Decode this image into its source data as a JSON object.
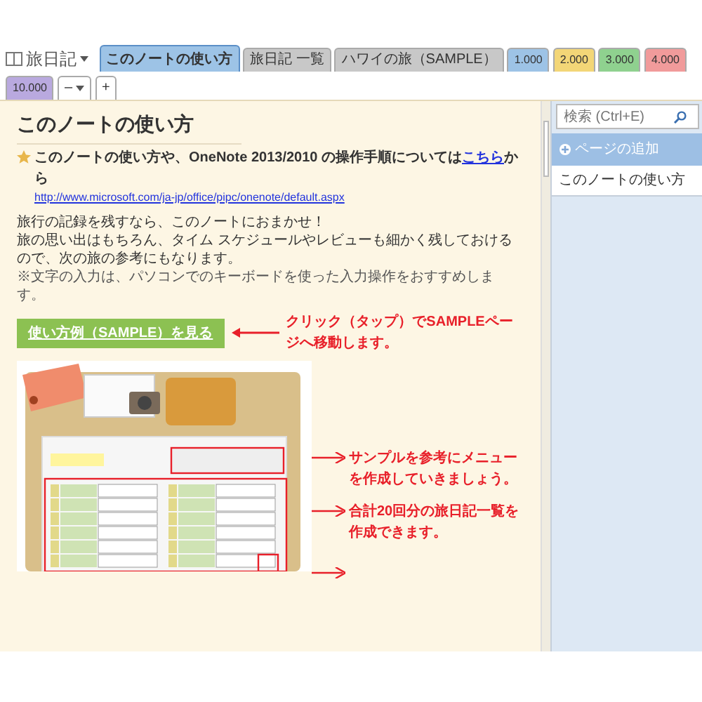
{
  "notebook": {
    "title": "旅日記"
  },
  "tabs": [
    {
      "label": "このノートの使い方",
      "selected": true,
      "color": "#9dc3e6"
    },
    {
      "label": "旅日記 一覧",
      "selected": false,
      "color": "#c8c8c8"
    },
    {
      "label": "ハワイの旅（SAMPLE）",
      "selected": false,
      "color": "#c8c8c8"
    },
    {
      "label": "1.000",
      "selected": false,
      "color": "#9dc3e6"
    },
    {
      "label": "2.000",
      "selected": false,
      "color": "#f3d677"
    },
    {
      "label": "3.000",
      "selected": false,
      "color": "#8fd18f"
    },
    {
      "label": "4.000",
      "selected": false,
      "color": "#f19b9b"
    },
    {
      "label": "10.000",
      "selected": false,
      "color": "#b9a9df"
    }
  ],
  "tab_controls": {
    "more": "–",
    "add": "+"
  },
  "search": {
    "placeholder": "検索 (Ctrl+E)"
  },
  "page_panel": {
    "add_page": "ページの追加",
    "pages": [
      {
        "title": "このノートの使い方",
        "selected": true
      }
    ]
  },
  "page": {
    "title": "このノートの使い方",
    "notice": "このノートの使い方や、OneNote 2013/2010 の操作手順については",
    "notice_link": "こちら",
    "notice_suffix": "から",
    "url": "http://www.microsoft.com/ja-jp/office/pipc/onenote/default.aspx",
    "intro": [
      "旅行の記録を残すなら、このノートにおまかせ！",
      "旅の思い出はもちろん、タイム スケジュールやレビューも細かく残しておけるので、次の旅の参考にもなります。"
    ],
    "note": "※文字の入力は、パソコンでのキーボードを使った入力操作をおすすめします。",
    "sample_button": "使い方例（SAMPLE）を見る",
    "sample_hint": "クリック（タップ）でSAMPLEページへ移動します。",
    "callouts": [
      "サンプルを参考にメニューを作成していきましょう。",
      "合計20回分の旅日記一覧を作成できます。"
    ]
  }
}
